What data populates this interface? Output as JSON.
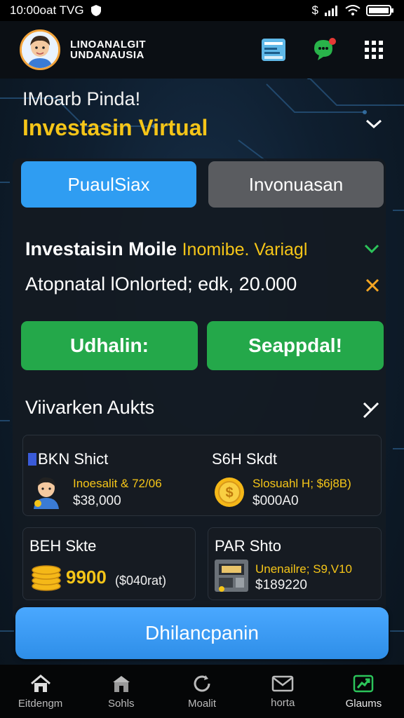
{
  "status_bar": {
    "time": "10:00oat TVG",
    "right_text": "$"
  },
  "header": {
    "app_name_line1": "LINOANALGIT",
    "app_name_line2": "UNDANAUSIA"
  },
  "intro": {
    "greeting": "IMoarb Pinda!",
    "title": "Investasin Virtual"
  },
  "tabs": [
    {
      "label": "PuaulSiax"
    },
    {
      "label": "Invonuasan"
    }
  ],
  "investment": {
    "title": "Investaisin Moile",
    "accent": "Inomibe. Variagl",
    "detail": "Atopnatal lOnlorted; edk, 20.000"
  },
  "buttons": {
    "left": "Udhalin:",
    "right": "Seappdal!"
  },
  "section": {
    "title": "Viivarken Aukts"
  },
  "assets": [
    {
      "title": "BKN Shict",
      "sub": "Inoesalit & 72/06",
      "value": "$38,000"
    },
    {
      "title": "S6H Skdt",
      "sub": "Slosuahl H; $6j8B)",
      "value": "$000A0"
    },
    {
      "title": "BEH Skte",
      "big": "9900",
      "value": "($040rat)"
    },
    {
      "title": "PAR Shto",
      "sub": "Unenailre; S9,V10",
      "value": "$189220"
    }
  ],
  "cta": {
    "label": "Dhilancpanin"
  },
  "nav": [
    {
      "label": "Eitdengm"
    },
    {
      "label": "Sohls"
    },
    {
      "label": "Moalit"
    },
    {
      "label": "horta"
    },
    {
      "label": "Glaums"
    }
  ],
  "colors": {
    "accent_yellow": "#f5c518",
    "tab_blue": "#2f9df2",
    "action_green": "#24a84a",
    "cta_blue": "#3a9cf5"
  }
}
